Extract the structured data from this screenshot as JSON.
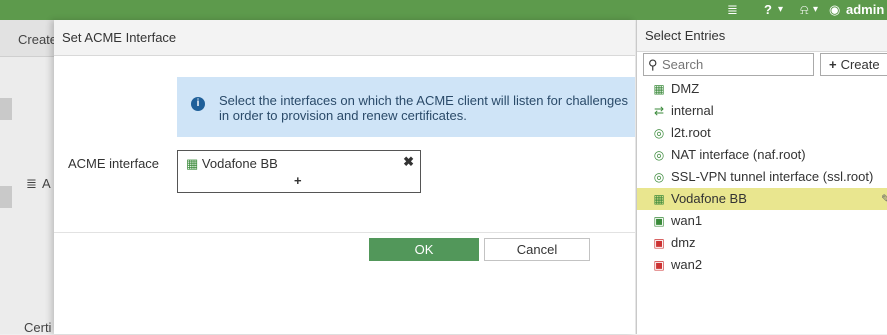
{
  "topbar": {
    "console_icon": "≣",
    "help_icon": "?",
    "help_caret": "▾",
    "bell_icon": "⍾",
    "bell_caret": "▾",
    "user_label": "admin"
  },
  "background": {
    "create_text": "Create",
    "row_a_icon": "≣",
    "row_a_text": "A",
    "cert_text": "Certi"
  },
  "modal": {
    "title": "Set ACME Interface",
    "info_message": "Select the interfaces on which the ACME client will listen for challenges in order to provision and renew certificates.",
    "field_label": "ACME interface",
    "selected_interface": "Vodafone BB",
    "remove_symbol": "✖",
    "add_symbol": "+",
    "ok_label": "OK",
    "cancel_label": "Cancel"
  },
  "panel": {
    "title": "Select Entries",
    "search_placeholder": "Search",
    "create_label": "Create",
    "create_symbol": "+",
    "entries": [
      {
        "label": "DMZ",
        "icon": "zone-icon"
      },
      {
        "label": "internal",
        "icon": "switch-icon"
      },
      {
        "label": "l2t.root",
        "icon": "tunnel-icon"
      },
      {
        "label": "NAT interface (naf.root)",
        "icon": "tunnel-icon"
      },
      {
        "label": "SSL-VPN tunnel interface (ssl.root)",
        "icon": "tunnel-icon"
      },
      {
        "label": "Vodafone BB",
        "icon": "zone-icon",
        "selected": true
      },
      {
        "label": "wan1",
        "icon": "port-up-icon"
      },
      {
        "label": "dmz",
        "icon": "port-down-icon"
      },
      {
        "label": "wan2",
        "icon": "port-down-icon"
      }
    ]
  },
  "colors": {
    "topbar": "#5d9a4c",
    "ok_button": "#52975a",
    "info_bg": "#cfe4f7",
    "selected_row": "#e9e68f"
  }
}
